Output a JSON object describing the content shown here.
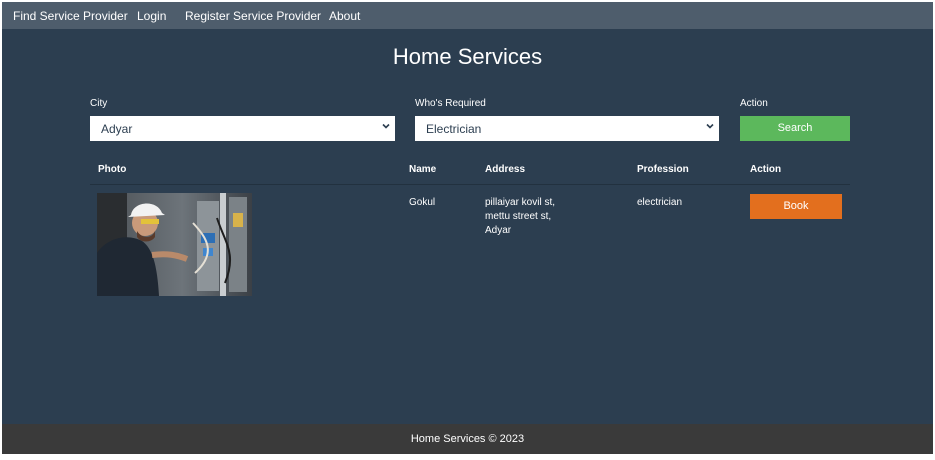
{
  "nav": {
    "items": [
      "Find Service Provider",
      "Login",
      "Register Service Provider",
      "About"
    ]
  },
  "page": {
    "title": "Home Services"
  },
  "filters": {
    "city_label": "City",
    "city_value": "Adyar",
    "required_label": "Who's Required",
    "required_value": "Electrician",
    "action_label": "Action",
    "search_label": "Search"
  },
  "table": {
    "headers": [
      "Photo",
      "Name",
      "Address",
      "Profession",
      "Action"
    ],
    "rows": [
      {
        "name": "Gokul",
        "address": [
          "pillaiyar kovil st,",
          "mettu street st,",
          "Adyar"
        ],
        "profession": "electrician",
        "action_label": "Book"
      }
    ]
  },
  "footer": {
    "text": "Home Services © 2023"
  },
  "colors": {
    "page_bg": "#2c3e50",
    "navbar_bg": "#4e5d6c",
    "search_button": "#5cb85c",
    "book_button": "#e36f1e",
    "footer_bg": "#3a3a3a"
  },
  "icons": {
    "select_arrow": "chevron-down-icon"
  }
}
